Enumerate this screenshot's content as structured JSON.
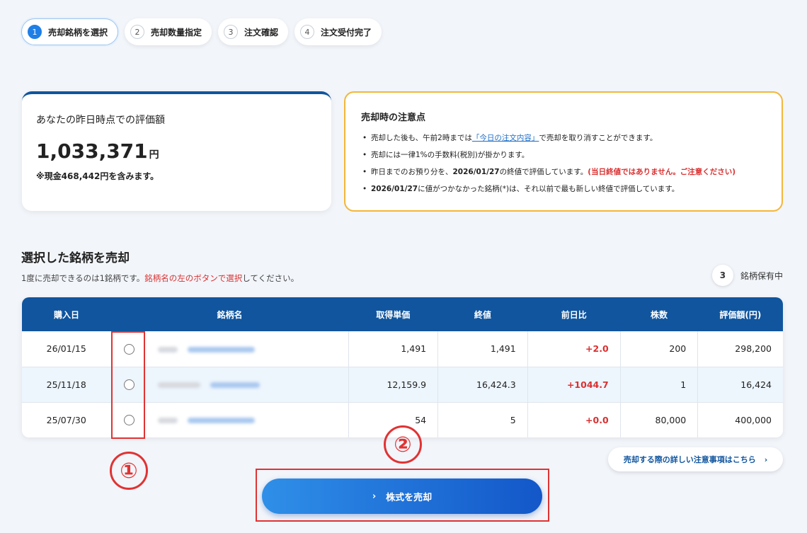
{
  "steps": [
    {
      "num": "1",
      "label": "売却銘柄を選択"
    },
    {
      "num": "2",
      "label": "売却数量指定"
    },
    {
      "num": "3",
      "label": "注文確認"
    },
    {
      "num": "4",
      "label": "注文受付完了"
    }
  ],
  "valuation": {
    "label": "あなたの昨日時点での評価額",
    "amount": "1,033,371",
    "unit": "円",
    "note": "※現金468,442円を含みます。"
  },
  "notice": {
    "title": "売却時の注意点",
    "item1_pre": "売却した後も、午前2時までは",
    "item1_link": "「今日の注文内容」",
    "item1_post": "で売却を取り消すことができます。",
    "item2": "売却には一律1%の手数料(税別)が掛かります。",
    "item3_pre": "昨日までのお預り分を、",
    "item3_date": "2026/01/27",
    "item3_mid": "の終値で評価しています。",
    "item3_warn": "(当日終値ではありません。ご注意ください)",
    "item4_date": "2026/01/27",
    "item4_post": "に値がつかなかった銘柄(*)は、それ以前で最も新しい終値で評価しています。"
  },
  "section": {
    "title": "選択した銘柄を売却",
    "desc_pre": "1度に売却できるのは1銘柄です。",
    "desc_red": "銘柄名の左のボタンで選択",
    "desc_post": "してください。",
    "holding_count": "3",
    "holding_label": "銘柄保有中"
  },
  "table": {
    "headers": [
      "購入日",
      "銘柄名",
      "取得単価",
      "終値",
      "前日比",
      "株数",
      "評価額(円)"
    ],
    "rows": [
      {
        "date": "26/01/15",
        "price": "1,491",
        "close": "1,491",
        "change": "+2.0",
        "shares": "200",
        "value": "298,200"
      },
      {
        "date": "25/11/18",
        "price": "12,159.9",
        "close": "16,424.3",
        "change": "+1044.7",
        "shares": "1",
        "value": "16,424"
      },
      {
        "date": "25/07/30",
        "price": "54",
        "close": "5",
        "change": "+0.0",
        "shares": "80,000",
        "value": "400,000"
      }
    ]
  },
  "annotations": {
    "circle1": "①",
    "circle2": "②"
  },
  "detail_link": {
    "label": "売却する際の詳しい注意事項はこちら",
    "arrow": "›"
  },
  "sell_button": {
    "arrow": "›",
    "label": "株式を売却"
  }
}
